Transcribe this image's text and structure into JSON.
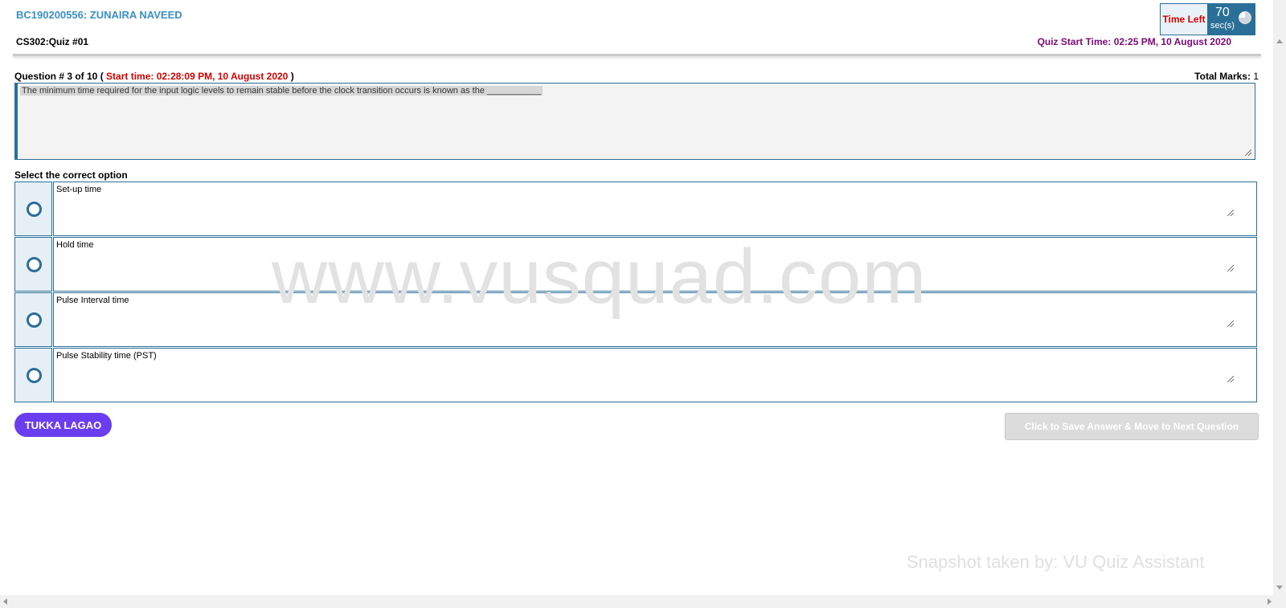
{
  "header": {
    "student": "BC190200556: ZUNAIRA NAVEED",
    "quiz_title": "CS302:Quiz #01",
    "quiz_start_label": "Quiz Start Time:",
    "quiz_start_value": "02:25 PM, 10 August 2020",
    "timer": {
      "label": "Time Left",
      "value": "70",
      "unit": "sec(s)",
      "icon": "clock-icon"
    }
  },
  "question": {
    "number_label": "Question # 3 of 10 (",
    "start_time": "Start time: 02:28:09 PM, 10 August 2020",
    "close_paren": ")",
    "total_marks_label": "Total Marks:",
    "total_marks_value": "1",
    "text": "The minimum time required for the input logic levels to remain stable before the clock transition occurs is known as the ___________"
  },
  "options_label": "Select the correct option",
  "options": [
    {
      "text": "Set-up time"
    },
    {
      "text": "Hold time"
    },
    {
      "text": "Pulse Interval time"
    },
    {
      "text": "Pulse Stability time (PST)"
    }
  ],
  "buttons": {
    "tukka": "TUKKA LAGAO",
    "save_next": "Click to Save Answer & Move to Next Question"
  },
  "watermarks": {
    "main": "www.vusquad.com",
    "snapshot": "Snapshot taken by: VU Quiz Assistant"
  },
  "colors": {
    "accent": "#2a6f98",
    "name_blue": "#3a8fc4",
    "alert_red": "#d20000",
    "start_purple": "#7a0a73",
    "tukka_purple": "#6a3ef0"
  }
}
